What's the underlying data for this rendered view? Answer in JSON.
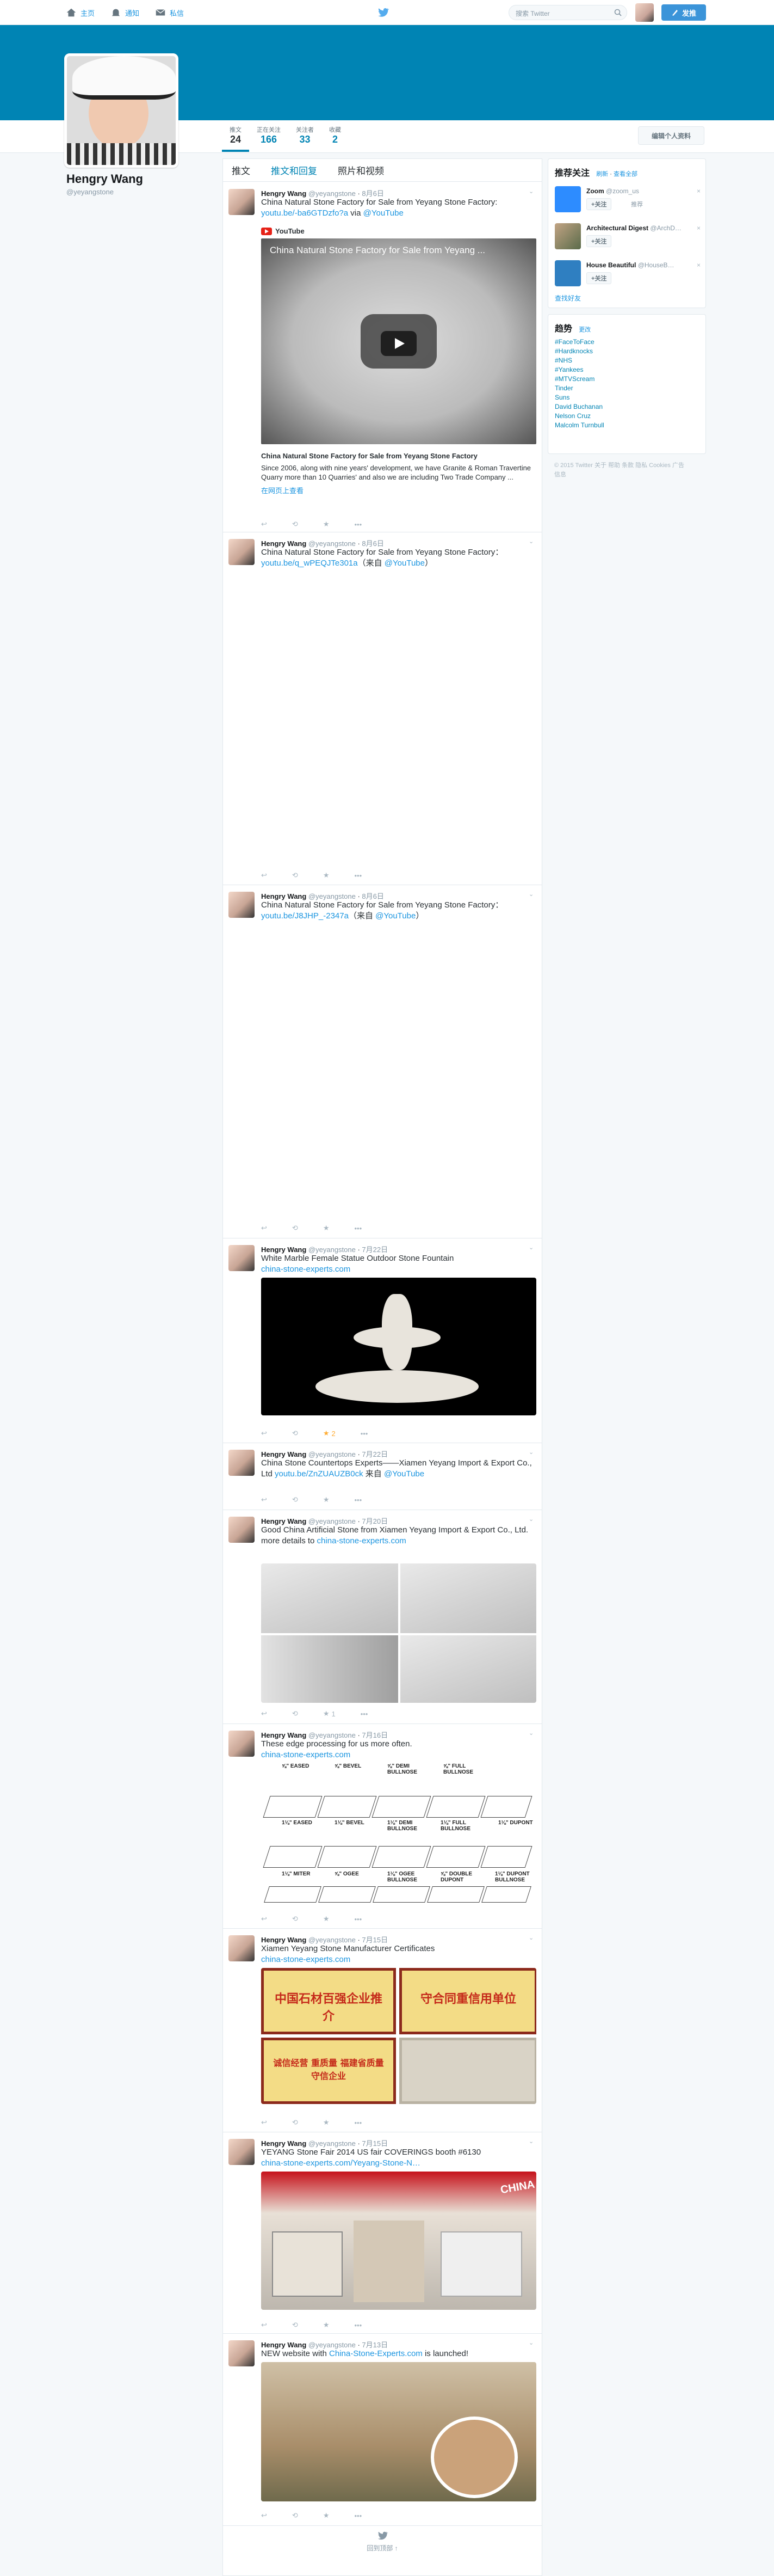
{
  "topbar": {
    "nav": [
      {
        "label": "主页",
        "icon": "home-icon"
      },
      {
        "label": "通知",
        "icon": "bell-icon"
      },
      {
        "label": "私信",
        "icon": "envelope-icon"
      }
    ],
    "search_placeholder": "搜索 Twitter",
    "tweet_button": "发推"
  },
  "profile": {
    "name": "Hengry Wang",
    "handle": "@yeyangstone",
    "edit_button": "编辑个人资料",
    "stats": [
      {
        "label": "推文",
        "value": "24"
      },
      {
        "label": "正在关注",
        "value": "166"
      },
      {
        "label": "关注者",
        "value": "33"
      },
      {
        "label": "收藏",
        "value": "2"
      }
    ],
    "banner_color": "#0084b4"
  },
  "timeline": {
    "tabs": [
      "推文",
      "推文和回复",
      "照片和视频"
    ],
    "footer": "回到顶部 ↑",
    "tweets": [
      {
        "name": "Hengry Wang",
        "handle": "@yeyangstone",
        "date": "8月6日",
        "text": "China Natural Stone Factory for Sale from Yeyang Stone Factory:",
        "link": "youtu.be/-ba6GTDzfo?a",
        "via": "via",
        "mention": "@YouTube",
        "card": {
          "source": "YouTube",
          "video_title": "China Natural Stone Factory for Sale from Yeyang ...",
          "title": "China Natural Stone Factory for Sale from Yeyang Stone Factory",
          "desc": "Since 2006, along with nine years' development, we have Granite & Roman Travertine Quarry more than 10 Quarries' and also we are including Two Trade Company ...",
          "link": "在网页上查看"
        }
      },
      {
        "name": "Hengry Wang",
        "handle": "@yeyangstone",
        "date": "8月6日",
        "text": "China Natural Stone Factory for Sale from Yeyang Stone Factory：",
        "link": "youtu.be/q_wPEQJTe301a",
        "suffix": "（来自 ",
        "mention": "@YouTube",
        "suffix_end": "）"
      },
      {
        "name": "Hengry Wang",
        "handle": "@yeyangstone",
        "date": "8月6日",
        "text": "China Natural Stone Factory for Sale from Yeyang Stone Factory：",
        "link": "youtu.be/J8JHP_-2347a",
        "suffix": "（来自 ",
        "mention": "@YouTube",
        "suffix_end": "）"
      },
      {
        "name": "Hengry Wang",
        "handle": "@yeyangstone",
        "date": "7月22日",
        "text": "White Marble Female Statue Outdoor Stone Fountain",
        "link": "china-stone-experts.com",
        "fav_count": "2"
      },
      {
        "name": "Hengry Wang",
        "handle": "@yeyangstone",
        "date": "7月22日",
        "text": "China Stone Countertops Experts——Xiamen Yeyang Import & Export Co., Ltd",
        "link": "youtu.be/ZnZUAUZB0ck",
        "suffix": " 来自 ",
        "mention": "@YouTube"
      },
      {
        "name": "Hengry Wang",
        "handle": "@yeyangstone",
        "date": "7月20日",
        "text": "Good China Artificial Stone from Xiamen Yeyang Import & Export Co., Ltd.",
        "text2": "more details to ",
        "link": "china-stone-experts.com",
        "fav_count": "1"
      },
      {
        "name": "Hengry Wang",
        "handle": "@yeyangstone",
        "date": "7月16日",
        "text": "These edge processing for us more often.",
        "link": "china-stone-experts.com",
        "edges": [
          "⅝\" EASED",
          "⅝\" BEVEL",
          "⅝\" DEMI BULLNOSE",
          "⅝\" FULL BULLNOSE",
          "1⅛\" EASED",
          "1⅛\" BEVEL",
          "1⅛\" DEMI BULLNOSE",
          "1⅛\" FULL BULLNOSE",
          "1⅛\" DUPONT",
          "1⅛\" MITER",
          "⅝\" OGEE",
          "1⅛\" OGEE BULLNOSE",
          "⅝\" DOUBLE DUPONT",
          "1⅛\" DUPONT BULLNOSE"
        ]
      },
      {
        "name": "Hengry Wang",
        "handle": "@yeyangstone",
        "date": "7月15日",
        "text": "Xiamen Yeyang Stone Manufacturer Certificates",
        "link": "china-stone-experts.com",
        "certs": [
          "中国石材百强企业推介",
          "守合同重信用单位",
          "诚信经营 重质量 福建省质量守信企业",
          ""
        ]
      },
      {
        "name": "Hengry Wang",
        "handle": "@yeyangstone",
        "date": "7月15日",
        "text": "YEYANG Stone Fair 2014 US fair COVERINGS booth #6130",
        "link": "china-stone-experts.com/Yeyang-Stone-N…",
        "booth_sign": "CHINA"
      },
      {
        "name": "Hengry Wang",
        "handle": "@yeyangstone",
        "date": "7月13日",
        "text": "NEW website with ",
        "link": "China-Stone-Experts.com",
        "suffix": " is launched!"
      }
    ]
  },
  "sidebar": {
    "who_to_follow": {
      "title": "推荐关注",
      "refresh": "刷新",
      "view_all": "查看全部",
      "follow_label": "关注",
      "users": [
        {
          "name": "Zoom",
          "handle": "@zoom_us",
          "extra": "推荐"
        },
        {
          "name": "Architectural Digest",
          "handle": "@ArchD…"
        },
        {
          "name": "House Beautiful",
          "handle": "@HouseB…"
        }
      ],
      "find_friends": "查找好友"
    },
    "trends": {
      "title": "趋势",
      "change": "更改",
      "items": [
        "#FaceToFace",
        "#Hardknocks",
        "#NHS",
        "#Yankees",
        "#MTVScream",
        "Tinder",
        "Suns",
        "David Buchanan",
        "Nelson Cruz",
        "Malcolm Turnbull"
      ]
    },
    "footer": "© 2015 Twitter  关于  帮助  条款  隐私  Cookies  广告信息"
  }
}
